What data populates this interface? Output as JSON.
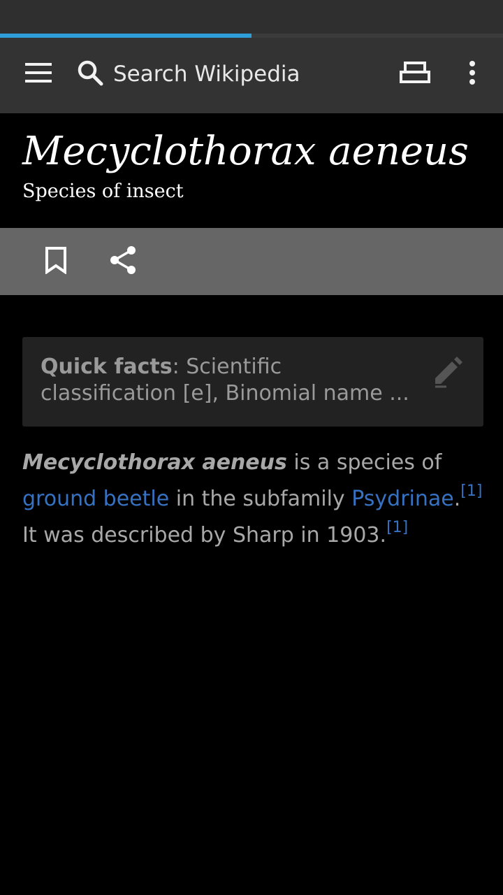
{
  "toolbar": {
    "search_placeholder": "Search Wikipedia",
    "load_progress": 0.5
  },
  "article": {
    "title": "Mecyclothorax aeneus",
    "description": "Species of insect"
  },
  "quick_facts": {
    "label": "Quick facts",
    "summary": ": Scientific classification [e], Binomial name ..."
  },
  "body": {
    "subject": "Mecyclothorax aeneus",
    "text_1": " is a species of ",
    "link_1": "ground beetle",
    "text_2": " in the subfamily ",
    "link_2": "Psydrinae",
    "text_3": ".",
    "ref_1": "[1]",
    "text_4": " It was described by Sharp in 1903.",
    "ref_2": "[1]"
  },
  "icons": {
    "menu": "menu-icon",
    "search": "search-icon",
    "reading_lists": "reading-lists-icon",
    "overflow": "more-vert-icon",
    "bookmark": "bookmark-icon",
    "share": "share-icon",
    "edit": "edit-pencil-icon"
  },
  "colors": {
    "toolbar_bg": "#333333",
    "action_bar_bg": "#666666",
    "progress": "#2d9ed8",
    "link": "#3671c2",
    "body_text": "#a8a8a8"
  }
}
